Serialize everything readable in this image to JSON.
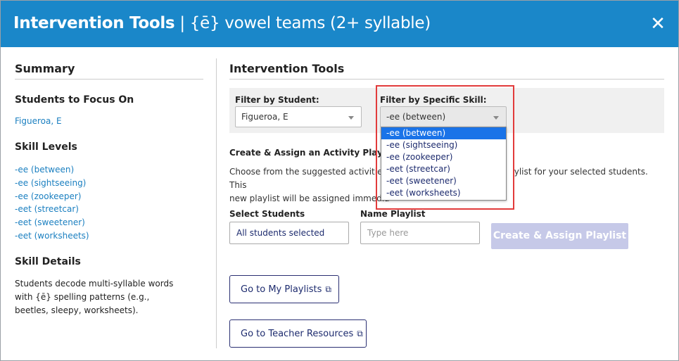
{
  "header": {
    "title_bold": "Intervention Tools",
    "title_rest": " | {ē} vowel teams (2+ syllable)",
    "close_icon": "close-icon"
  },
  "summary": {
    "title": "Summary",
    "students_title": "Students to Focus On",
    "students": [
      "Figueroa, E"
    ],
    "skill_levels_title": "Skill Levels",
    "skill_levels": [
      "-ee (between)",
      "-ee (sightseeing)",
      "-ee (zookeeper)",
      "-eet (streetcar)",
      "-eet (sweetener)",
      "-eet (worksheets)"
    ],
    "skill_details_title": "Skill Details",
    "skill_details": "Students decode multi-syllable words with {ē} spelling patterns (e.g., beetles, sleepy, worksheets)."
  },
  "tools": {
    "title": "Intervention Tools",
    "filter_student_label": "Filter by Student:",
    "filter_student_value": "Figueroa, E",
    "filter_skill_label": "Filter by Specific Skill:",
    "filter_skill_value": "-ee (between)",
    "skill_options": [
      "-ee (between)",
      "-ee (sightseeing)",
      "-ee (zookeeper)",
      "-eet (streetcar)",
      "-eet (sweetener)",
      "-eet (worksheets)"
    ],
    "selected_option_index": 0,
    "playlist_title": "Create & Assign an Activity Playlist",
    "desc_line1_a": "Choose from the suggested activities",
    "desc_line1_b": "ylist for your selected students. This",
    "desc_line2": "new playlist will be assigned immedia",
    "select_students_label": "Select Students",
    "select_students_value": "All students selected",
    "name_playlist_label": "Name Playlist",
    "name_playlist_placeholder": "Type here",
    "create_button": "Create & Assign Playlist",
    "my_playlists_button": "Go to My Playlists",
    "teacher_resources_button": "Go to Teacher Resources"
  },
  "colors": {
    "header_bg": "#1a87c9",
    "link": "#1a7fc0",
    "highlight": "#e23b3b",
    "disabled_button": "#c6c9e8"
  }
}
